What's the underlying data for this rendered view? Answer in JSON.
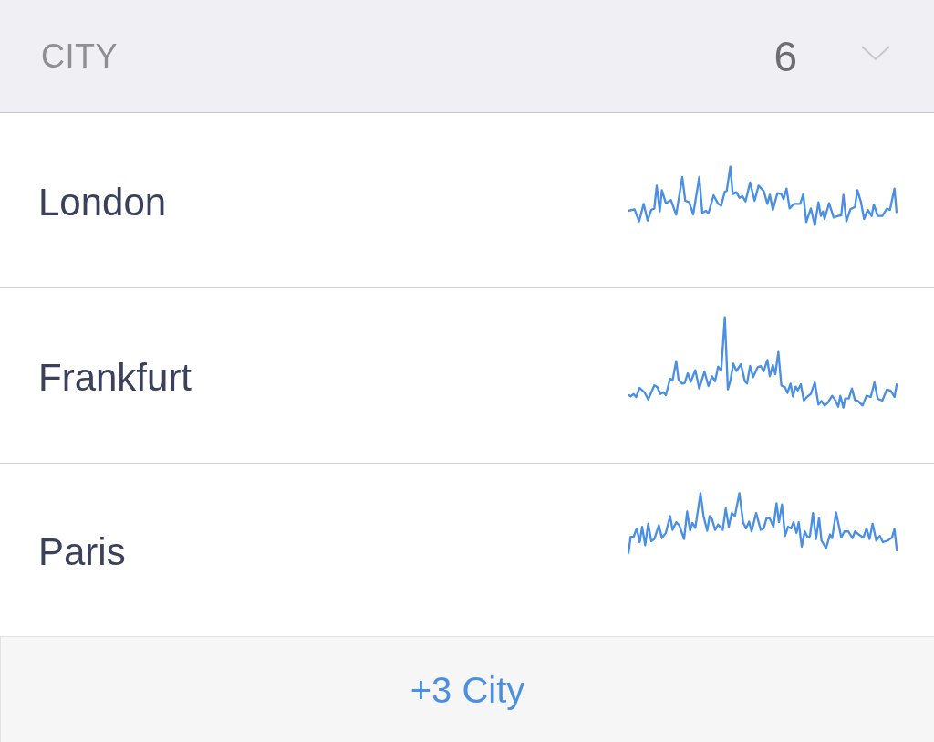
{
  "header": {
    "title": "CITY",
    "count": "6"
  },
  "cities": [
    {
      "name": "London"
    },
    {
      "name": "Frankfurt"
    },
    {
      "name": "Paris"
    }
  ],
  "footer": {
    "more_button": "+3 City"
  }
}
